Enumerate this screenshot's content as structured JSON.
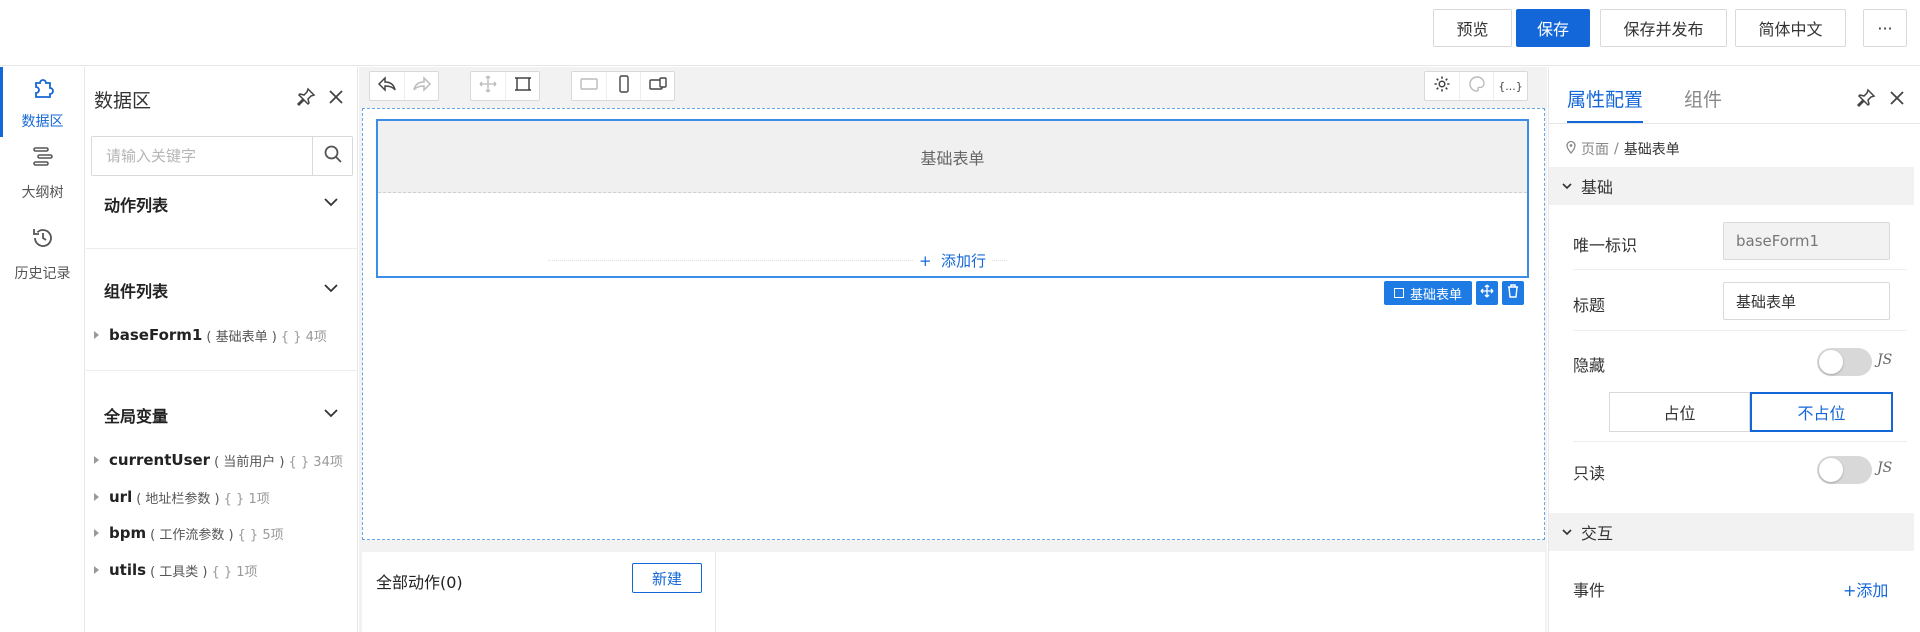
{
  "toolbar": {
    "preview": "预览",
    "save": "保存",
    "save_publish": "保存并发布",
    "language": "简体中文",
    "more": "···"
  },
  "rail": {
    "items": [
      {
        "label": "数据区",
        "icon": "puzzle-icon",
        "active": true
      },
      {
        "label": "大纲树",
        "icon": "outline-tree-icon",
        "active": false
      },
      {
        "label": "历史记录",
        "icon": "history-icon",
        "active": false
      }
    ]
  },
  "data_panel": {
    "title": "数据区",
    "search_placeholder": "请输入关键字",
    "sections": {
      "actions": "动作列表",
      "components": "组件列表",
      "globals": "全局变量"
    },
    "component_items": [
      {
        "name": "baseForm1",
        "desc": "( 基础表单 )",
        "count": "{ } 4项"
      }
    ],
    "global_items": [
      {
        "name": "currentUser",
        "desc": "( 当前用户 )",
        "count": "{ } 34项"
      },
      {
        "name": "url",
        "desc": "( 地址栏参数 )",
        "count": "{ } 1项"
      },
      {
        "name": "bpm",
        "desc": "( 工作流参数 )",
        "count": "{ } 5项"
      },
      {
        "name": "utils",
        "desc": "( 工具类 )",
        "count": "{ } 1项"
      }
    ]
  },
  "canvas": {
    "form_title": "基础表单",
    "add_row": "添加行",
    "selected_tag": "基础表单",
    "all_actions": "全部动作(0)",
    "new_button": "新建",
    "gear_label": "{...}"
  },
  "props": {
    "tabs": [
      "属性配置",
      "组件"
    ],
    "breadcrumb": {
      "parent": "页面",
      "sep": "/",
      "current": "基础表单"
    },
    "groups": {
      "basic": "基础",
      "interaction": "交互"
    },
    "fields": {
      "unique_id_label": "唯一标识",
      "unique_id_value": "baseForm1",
      "title_label": "标题",
      "title_value": "基础表单",
      "hidden_label": "隐藏",
      "readonly_label": "只读",
      "js": "JS",
      "placeholder_on": "占位",
      "placeholder_off": "不占位",
      "event_label": "事件",
      "add": "+添加"
    }
  },
  "colors": {
    "accent": "#1467d8",
    "selection": "#3b8de6"
  }
}
